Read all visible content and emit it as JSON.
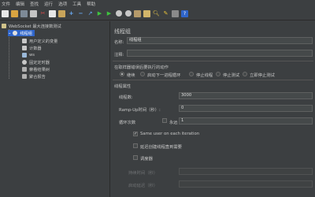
{
  "menu": [
    "文件",
    "编辑",
    "查找",
    "运行",
    "选项",
    "工具",
    "帮助"
  ],
  "toolbar_icons": [
    "new-file-icon",
    "templates-icon",
    "open-icon",
    "save-icon",
    "cut-icon",
    "copy-icon",
    "paste-icon",
    "expand-icon",
    "collapse-icon",
    "toggle-icon",
    "start-icon",
    "start-no-pause-icon",
    "stop-icon",
    "shutdown-icon",
    "clear-icon",
    "clear-all-icon",
    "search-icon",
    "reset-search-icon",
    "function-helper-icon",
    "help-icon"
  ],
  "tree": {
    "root": "WebSocket 最大连接数测试",
    "thread_group": "线程组",
    "children": [
      "用户定义的变量",
      "计数器",
      "ws",
      "固定定时器",
      "察看结果树",
      "聚合报告"
    ]
  },
  "panel": {
    "title": "线程组",
    "name_label": "名称:",
    "name_value": "线程组",
    "comment_label": "注释:",
    "comment_value": "",
    "action_heading": "在取样器错误后要执行的动作",
    "actions": [
      "继续",
      "启动下一进程循环",
      "停止线程",
      "停止测试",
      "立即停止测试"
    ],
    "selected_action": 0,
    "props_heading": "线程属性",
    "threads_label": "线程数:",
    "threads_value": "3000",
    "rampup_label": "Ramp-Up时间（秒）:",
    "rampup_value": "0",
    "loop_label": "循环次数",
    "forever_label": "永远",
    "loop_value": "1",
    "same_user_label": "Same user on each iteration",
    "same_user_checked": true,
    "delay_label": "延迟创建线程直到需要",
    "delay_checked": false,
    "scheduler_label": "调度器",
    "scheduler_checked": false,
    "duration_label": "持续时间（秒）",
    "startup_delay_label": "启动延迟（秒）"
  }
}
